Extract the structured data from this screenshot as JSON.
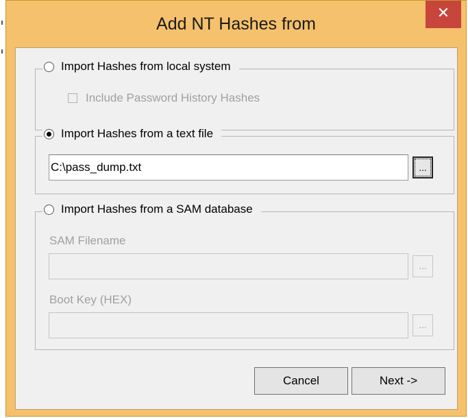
{
  "window": {
    "title": "Add NT Hashes from",
    "close_glyph": "✕"
  },
  "local_group": {
    "label": "Import Hashes from local system",
    "selected": false,
    "history_checkbox_label": "Include Password History Hashes",
    "history_checked": false
  },
  "text_group": {
    "label": "Import Hashes from a text file",
    "selected": true,
    "file_path": "C:\\pass_dump.txt",
    "browse_label": "..."
  },
  "sam_group": {
    "label": "Import Hashes from a SAM database",
    "selected": false,
    "sam_filename_label": "SAM Filename",
    "sam_filename_value": "",
    "boot_key_label": "Boot Key (HEX)",
    "boot_key_value": "",
    "browse_label": "..."
  },
  "buttons": {
    "cancel": "Cancel",
    "next": "Next ->"
  },
  "colors": {
    "frame": "#f5c16c",
    "close": "#c7453a",
    "client": "#f0f0f0"
  }
}
